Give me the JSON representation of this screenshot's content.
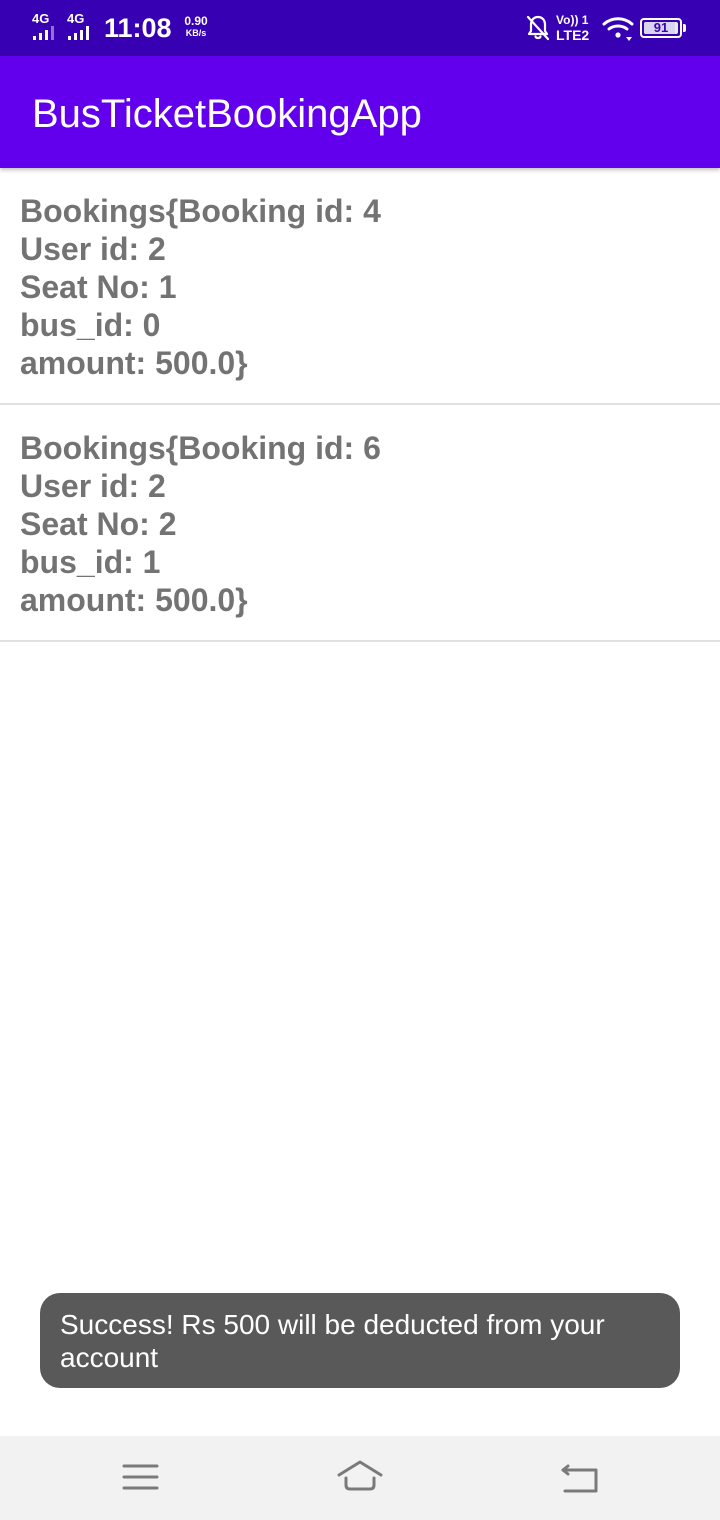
{
  "status_bar": {
    "network_1": "4G",
    "network_2": "4G",
    "time": "11:08",
    "speed_value": "0.90",
    "speed_unit": "KB/s",
    "volte_top": "Vo)) 1",
    "volte_bottom": "LTE2",
    "battery_level": "91",
    "icons": [
      "signal-icon",
      "bell-off-icon",
      "wifi-icon",
      "battery-icon"
    ]
  },
  "app_bar": {
    "title": "BusTicketBookingApp",
    "color": "#6200ee",
    "status_color": "#3700b3"
  },
  "bookings": [
    {
      "line1": "Bookings{Booking id: 4",
      "line2": "User id: 2",
      "line3": "Seat No: 1",
      "line4": "bus_id: 0",
      "line5": "amount: 500.0}"
    },
    {
      "line1": "Bookings{Booking id: 6",
      "line2": "User id: 2",
      "line3": "Seat No: 2",
      "line4": "bus_id: 1",
      "line5": "amount: 500.0}"
    }
  ],
  "toast": {
    "message": "Success! Rs 500 will be deducted from your account"
  },
  "nav_bar": {
    "icons": [
      "menu-icon",
      "home-icon",
      "back-icon"
    ]
  }
}
